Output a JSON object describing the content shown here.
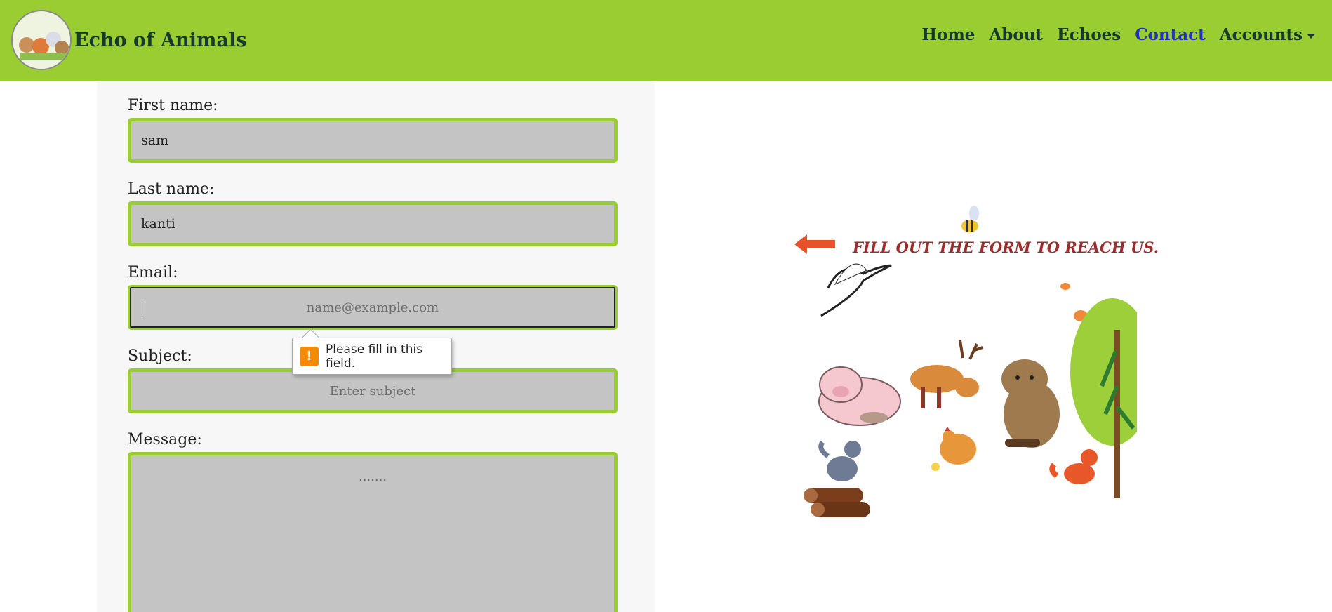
{
  "header": {
    "brand": "Echo of Animals",
    "nav": [
      {
        "label": "Home",
        "active": false
      },
      {
        "label": "About",
        "active": false
      },
      {
        "label": "Echoes",
        "active": false
      },
      {
        "label": "Contact",
        "active": true
      },
      {
        "label": "Accounts",
        "active": false,
        "dropdown": true
      }
    ]
  },
  "form": {
    "first_name": {
      "label": "First name:",
      "value": "sam"
    },
    "last_name": {
      "label": "Last name:",
      "value": "kanti"
    },
    "email": {
      "label": "Email:",
      "value": "",
      "placeholder": "name@example.com"
    },
    "subject": {
      "label": "Subject:",
      "value": "",
      "placeholder": "Enter subject"
    },
    "message": {
      "label": "Message:",
      "value": "",
      "placeholder": "......."
    },
    "validation_tooltip": "Please fill in this field."
  },
  "illustration": {
    "caption": "FILL OUT THE FORM TO REACH US.",
    "animals": [
      "pig",
      "deer",
      "beaver",
      "wolf",
      "hen",
      "chick",
      "fox",
      "crane",
      "bee",
      "butterfly",
      "tree",
      "logs"
    ]
  },
  "colors": {
    "accent": "#9acd32",
    "nav_text": "#163a2c",
    "active_link": "#2233b8",
    "caption": "#9b2d2d",
    "field_bg": "#c4c4c4",
    "warning": "#f48a06"
  }
}
